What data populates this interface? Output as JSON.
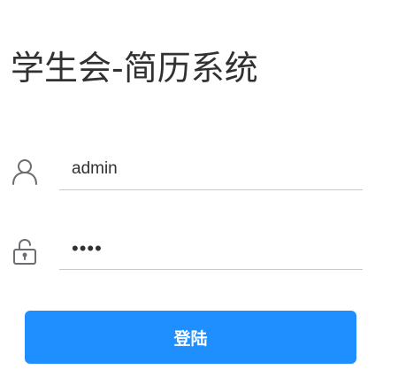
{
  "page": {
    "title": "学生会-简历系统"
  },
  "login_form": {
    "username": {
      "icon": "user-icon",
      "value": "admin"
    },
    "password": {
      "icon": "unlock-icon",
      "value": "••••"
    },
    "submit_label": "登陆"
  },
  "colors": {
    "accent": "#1f8fff",
    "text": "#303133",
    "icon": "#6b6d70",
    "divider": "#c8c9cc"
  }
}
